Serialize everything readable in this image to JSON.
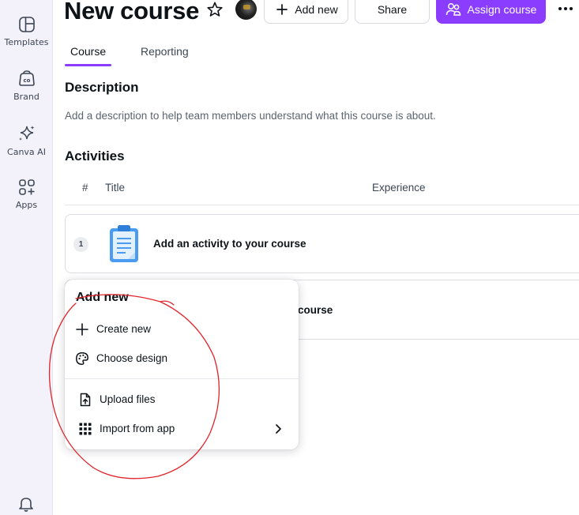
{
  "sidebar": {
    "items": [
      {
        "label": "Templates",
        "icon": "templates-icon"
      },
      {
        "label": "Brand",
        "icon": "brand-icon"
      },
      {
        "label": "Canva AI",
        "icon": "sparkle-icon"
      },
      {
        "label": "Apps",
        "icon": "apps-icon"
      }
    ],
    "bottom_icon": "bell-icon"
  },
  "header": {
    "title": "New course",
    "add_new_label": "Add new",
    "share_label": "Share",
    "assign_label": "Assign course"
  },
  "tabs": [
    {
      "label": "Course",
      "active": true
    },
    {
      "label": "Reporting",
      "active": false
    }
  ],
  "description": {
    "heading": "Description",
    "text": "Add a description to help team members understand what this course is about."
  },
  "activities": {
    "heading": "Activities",
    "columns": [
      "#",
      "Title",
      "Experience"
    ],
    "rows": [
      {
        "number": "1",
        "title": "Add an activity to your course"
      },
      {
        "title_visible": "course"
      }
    ]
  },
  "add_new_menu": {
    "title": "Add new",
    "items": [
      {
        "label": "Create new",
        "icon": "plus-icon"
      },
      {
        "label": "Choose design",
        "icon": "palette-icon"
      },
      {
        "label": "Upload files",
        "icon": "upload-file-icon"
      },
      {
        "label": "Import from app",
        "icon": "grid-apps-icon",
        "has_submenu": true
      }
    ]
  },
  "colors": {
    "accent": "#8b3dff",
    "sidebar_bg": "#f3f2fa",
    "annotation": "#e0242b"
  }
}
